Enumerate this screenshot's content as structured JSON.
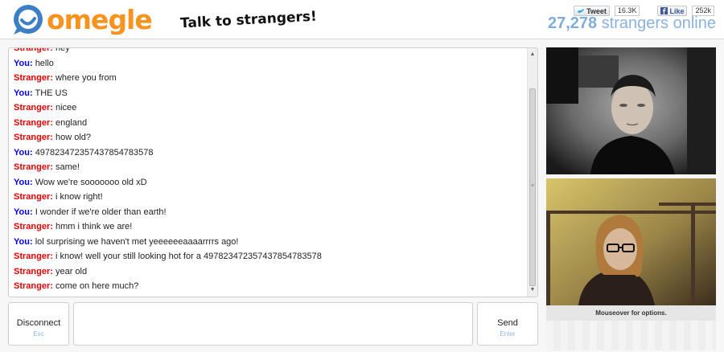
{
  "header": {
    "logo_text": "omegle",
    "tagline": "Talk to strangers!",
    "social": {
      "tweet_label": "Tweet",
      "tweet_count": "16.3K",
      "like_label": "Like",
      "like_count": "252k"
    },
    "online_count": "27,278",
    "online_suffix": "strangers online"
  },
  "chat": {
    "messages": [
      {
        "sender": "Stranger:",
        "text": "hey"
      },
      {
        "sender": "You:",
        "text": "hello"
      },
      {
        "sender": "Stranger:",
        "text": "where you from"
      },
      {
        "sender": "You:",
        "text": "THE US"
      },
      {
        "sender": "Stranger:",
        "text": "nicee"
      },
      {
        "sender": "Stranger:",
        "text": "england"
      },
      {
        "sender": "Stranger:",
        "text": "how old?"
      },
      {
        "sender": "You:",
        "text": "497823472357437854783578"
      },
      {
        "sender": "Stranger:",
        "text": "same!"
      },
      {
        "sender": "You:",
        "text": "Wow we're sooooooo old xD"
      },
      {
        "sender": "Stranger:",
        "text": "i know right!"
      },
      {
        "sender": "You:",
        "text": "I wonder if we're older than earth!"
      },
      {
        "sender": "Stranger:",
        "text": "hmm i think we are!"
      },
      {
        "sender": "You:",
        "text": "lol surprising we haven't met yeeeeeeaaaarrrrs ago!"
      },
      {
        "sender": "Stranger:",
        "text": "i know! well your still looking hot for a 497823472357437854783578"
      },
      {
        "sender": "Stranger:",
        "text": "year old"
      },
      {
        "sender": "Stranger:",
        "text": "come on here much?"
      }
    ]
  },
  "controls": {
    "disconnect_label": "Disconnect",
    "disconnect_hint": "Esc",
    "send_label": "Send",
    "send_hint": "Enter",
    "input_value": ""
  },
  "video": {
    "mouseover_text": "Mouseover for options."
  },
  "colors": {
    "stranger": "#e60000",
    "you": "#0000e6",
    "brand_orange": "#f7931e",
    "brand_blue": "#7eaedb"
  }
}
